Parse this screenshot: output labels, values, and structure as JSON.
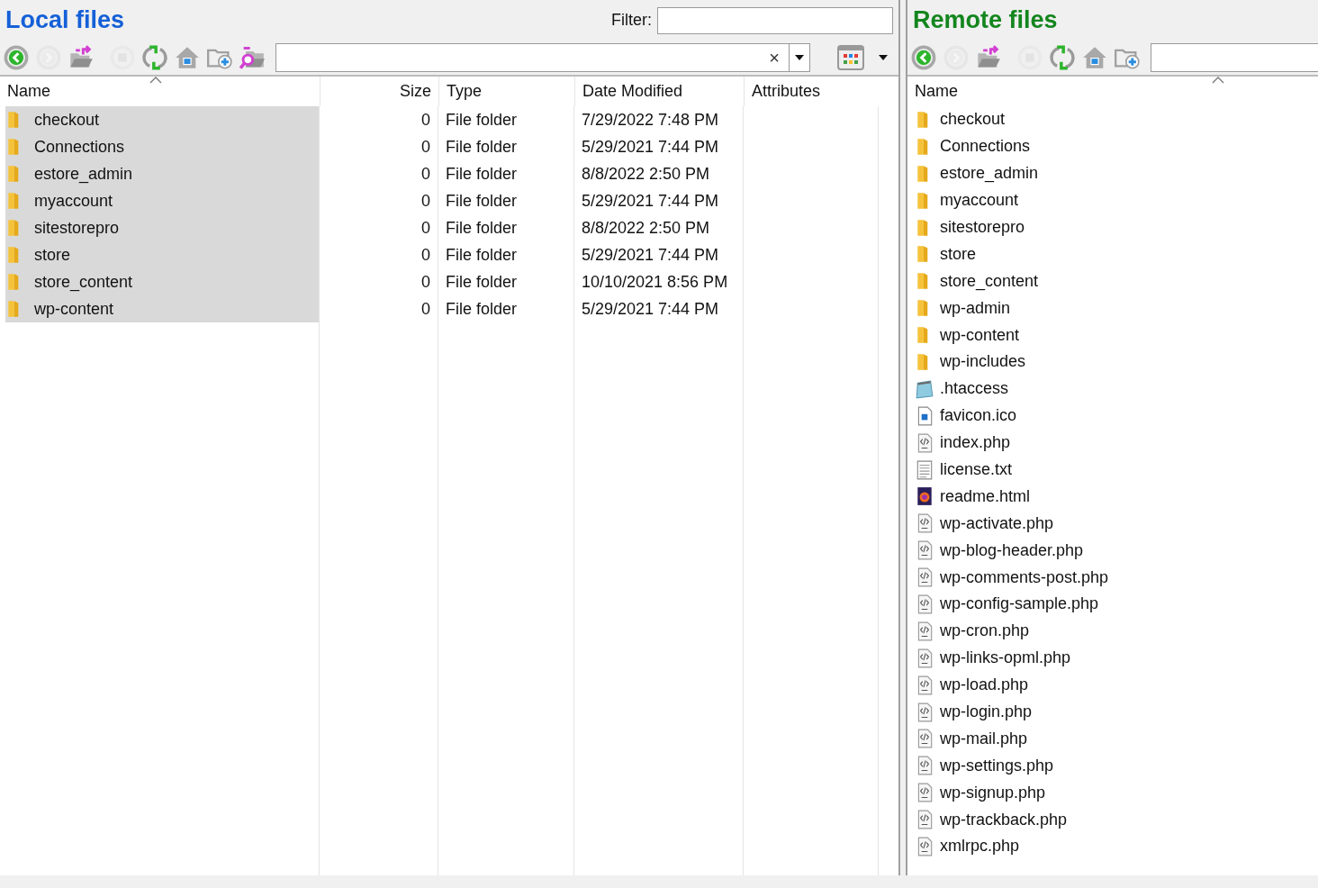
{
  "local": {
    "title": "Local files",
    "filter_label": "Filter:",
    "toolbar": [
      {
        "kind": "back",
        "disabled": false
      },
      {
        "kind": "forward",
        "disabled": true
      },
      {
        "kind": "up",
        "disabled": false
      },
      {
        "kind": "stop",
        "disabled": true
      },
      {
        "kind": "refresh",
        "disabled": false
      },
      {
        "kind": "home",
        "disabled": false
      },
      {
        "kind": "new-folder",
        "disabled": false
      },
      {
        "kind": "find",
        "disabled": false
      }
    ],
    "path_clear": "×",
    "columns": [
      "Name",
      "Size",
      "Type",
      "Date Modified",
      "Attributes"
    ],
    "rows": [
      {
        "name": "checkout",
        "size": "0",
        "type": "File folder",
        "date": "7/29/2022 7:48 PM",
        "selected": true
      },
      {
        "name": "Connections",
        "size": "0",
        "type": "File folder",
        "date": "5/29/2021 7:44 PM",
        "selected": true
      },
      {
        "name": "estore_admin",
        "size": "0",
        "type": "File folder",
        "date": "8/8/2022 2:50 PM",
        "selected": true
      },
      {
        "name": "myaccount",
        "size": "0",
        "type": "File folder",
        "date": "5/29/2021 7:44 PM",
        "selected": true
      },
      {
        "name": "sitestorepro",
        "size": "0",
        "type": "File folder",
        "date": "8/8/2022 2:50 PM",
        "selected": true
      },
      {
        "name": "store",
        "size": "0",
        "type": "File folder",
        "date": "5/29/2021 7:44 PM",
        "selected": true
      },
      {
        "name": "store_content",
        "size": "0",
        "type": "File folder",
        "date": "10/10/2021 8:56 PM",
        "selected": true
      },
      {
        "name": "wp-content",
        "size": "0",
        "type": "File folder",
        "date": "5/29/2021 7:44 PM",
        "selected": true
      }
    ]
  },
  "remote": {
    "title": "Remote files",
    "toolbar": [
      {
        "kind": "back",
        "disabled": false
      },
      {
        "kind": "forward",
        "disabled": true
      },
      {
        "kind": "up",
        "disabled": false
      },
      {
        "kind": "stop",
        "disabled": true
      },
      {
        "kind": "refresh",
        "disabled": false
      },
      {
        "kind": "home",
        "disabled": false
      },
      {
        "kind": "new-folder",
        "disabled": false
      }
    ],
    "columns": [
      "Name"
    ],
    "files": [
      {
        "name": "checkout",
        "kind": "folder"
      },
      {
        "name": "Connections",
        "kind": "folder"
      },
      {
        "name": "estore_admin",
        "kind": "folder"
      },
      {
        "name": "myaccount",
        "kind": "folder"
      },
      {
        "name": "sitestorepro",
        "kind": "folder"
      },
      {
        "name": "store",
        "kind": "folder"
      },
      {
        "name": "store_content",
        "kind": "folder"
      },
      {
        "name": "wp-admin",
        "kind": "folder"
      },
      {
        "name": "wp-content",
        "kind": "folder"
      },
      {
        "name": "wp-includes",
        "kind": "folder"
      },
      {
        "name": ".htaccess",
        "kind": "notepad"
      },
      {
        "name": "favicon.ico",
        "kind": "image"
      },
      {
        "name": "index.php",
        "kind": "code"
      },
      {
        "name": "license.txt",
        "kind": "text"
      },
      {
        "name": "readme.html",
        "kind": "browser"
      },
      {
        "name": "wp-activate.php",
        "kind": "code"
      },
      {
        "name": "wp-blog-header.php",
        "kind": "code"
      },
      {
        "name": "wp-comments-post.php",
        "kind": "code"
      },
      {
        "name": "wp-config-sample.php",
        "kind": "code"
      },
      {
        "name": "wp-cron.php",
        "kind": "code"
      },
      {
        "name": "wp-links-opml.php",
        "kind": "code"
      },
      {
        "name": "wp-load.php",
        "kind": "code"
      },
      {
        "name": "wp-login.php",
        "kind": "code"
      },
      {
        "name": "wp-mail.php",
        "kind": "code"
      },
      {
        "name": "wp-settings.php",
        "kind": "code"
      },
      {
        "name": "wp-signup.php",
        "kind": "code"
      },
      {
        "name": "wp-trackback.php",
        "kind": "code"
      },
      {
        "name": "xmlrpc.php",
        "kind": "code"
      }
    ]
  }
}
